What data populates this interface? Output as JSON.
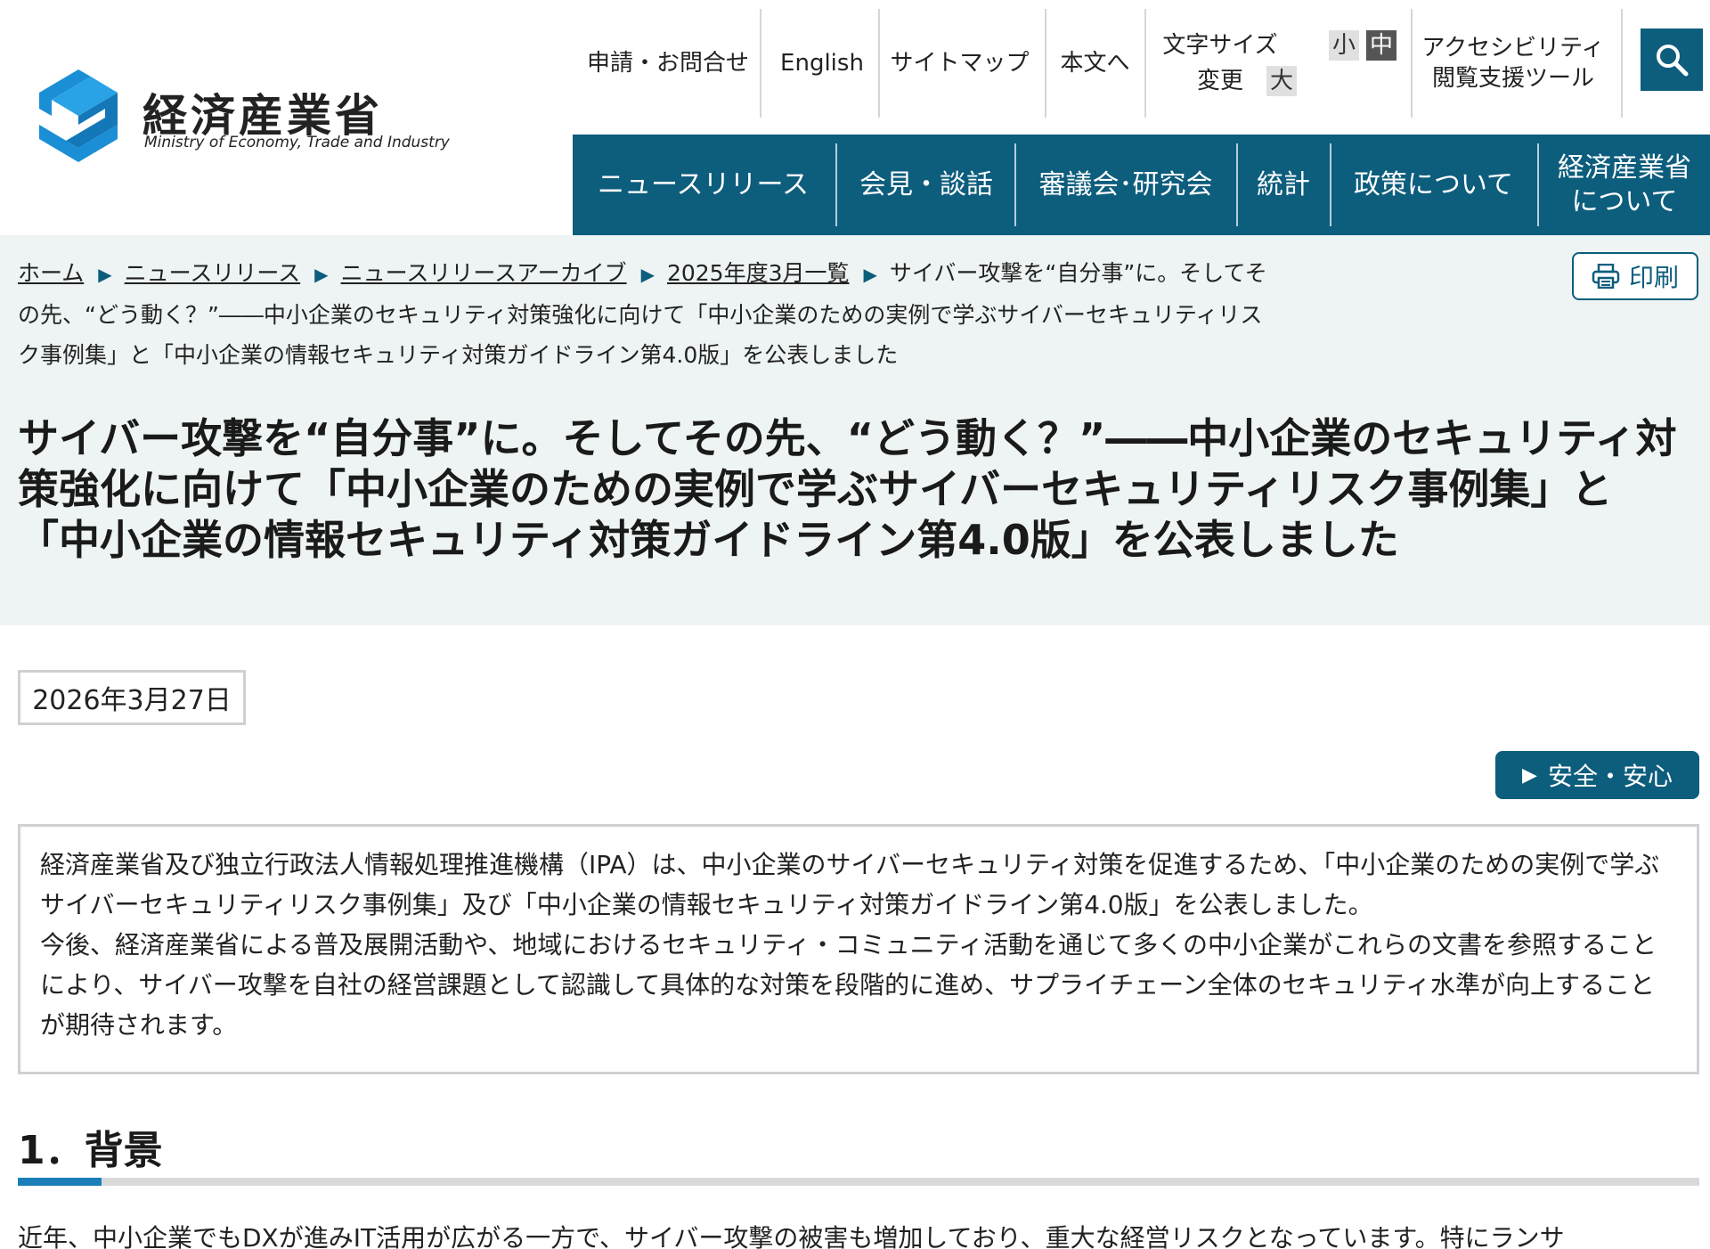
{
  "brand": {
    "name_jp": "経済産業省",
    "name_en": "Ministry of Economy, Trade and Industry",
    "primary_color": "#0d5d7d"
  },
  "utility_nav": {
    "apply": "申請・お問合せ",
    "english": "English",
    "sitemap": "サイトマップ",
    "skip_to_main": "本文へ",
    "font_size_label": "文字サイズ変更",
    "font_small": "小",
    "font_medium": "中",
    "font_large": "大",
    "accessibility": "アクセシビリティ閲覧支援ツール",
    "search_icon": "search-icon"
  },
  "main_nav": [
    {
      "label": "ニュースリリース"
    },
    {
      "label": "会見・談話"
    },
    {
      "label": "審議会･研究会"
    },
    {
      "label": "統計"
    },
    {
      "label": "政策について"
    },
    {
      "label": "経済産業省について"
    }
  ],
  "breadcrumb": {
    "items": [
      "ホーム",
      "ニュースリリース",
      "ニュースリリースアーカイブ",
      "2025年度3月一覧"
    ],
    "current": "サイバー攻撃を“自分事”に。そしてその先、“どう動く？”――中小企業のセキュリティ対策強化に向けて「中小企業のための実例で学ぶサイバーセキュリティリスク事例集」と「中小企業の情報セキュリティ対策ガイドライン第4.0版」を公表しました"
  },
  "print_label": "印刷",
  "page_title": "サイバー攻撃を“自分事”に。そしてその先、“どう動く？”――中小企業のセキュリティ対策強化に向けて「中小企業のための実例で学ぶサイバーセキュリティリスク事例集」と「中小企業の情報セキュリティ対策ガイドライン第4.0版」を公表しました",
  "date": "2026年3月27日",
  "category_tag": "安全・安心",
  "summary": {
    "para1": "経済産業省及び独立行政法人情報処理推進機構（IPA）は、中小企業のサイバーセキュリティ対策を促進するため、「中小企業のための実例で学ぶサイバーセキュリティリスク事例集」及び「中小企業の情報セキュリティ対策ガイドライン第4.0版」を公表しました。",
    "para2": "今後、経済産業省による普及展開活動や、地域におけるセキュリティ・コミュニティ活動を通じて多くの中小企業がこれらの文書を参照することにより、サイバー攻撃を自社の経営課題として認識して具体的な対策を段階的に進め、サプライチェーン全体のセキュリティ水準が向上することが期待されます。"
  },
  "section1": {
    "heading": "1．背景",
    "body": "近年、中小企業でもDXが進みIT活用が広がる一方で、サイバー攻撃の被害も増加しており、重大な経営リスクとなっています。特にランサ"
  }
}
